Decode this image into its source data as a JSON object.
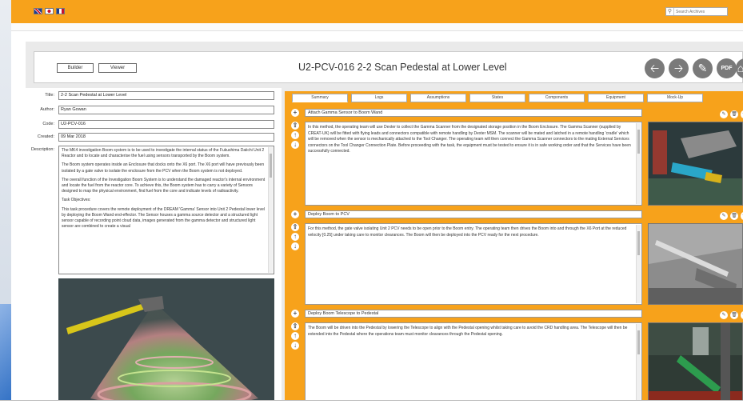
{
  "topbar": {
    "flags": [
      "flag-uk-icon",
      "flag-jp-icon",
      "flag-fr-icon"
    ],
    "search": {
      "placeholder": "Search Archives"
    }
  },
  "header": {
    "builder_label": "Builder",
    "viewer_label": "Viewer",
    "title": "U2-PCV-016 2-2 Scan Pedestal at Lower Level",
    "icons": [
      "arrow-left-icon",
      "arrow-right-icon",
      "pencil-icon",
      "pdf-icon",
      "home-icon"
    ]
  },
  "form": {
    "title_label": "Title:",
    "title_value": "2-2 Scan Pedestal at Lower Level",
    "author_label": "Author:",
    "author_value": "Ryan Gowan",
    "code_label": "Code:",
    "code_value": "U2-PCV-016",
    "created_label": "Created:",
    "created_value": "09 Mar 2018",
    "description_label": "Description:",
    "description": [
      "The MK4 investigation Boom system is to be used to investigate the internal status of the Fukushima Daiichi Unit 2 Reactor and to locate and characterise the fuel using sensors transported by the Boom system.",
      "The Boom system operates inside an Enclosure that docks onto the X6 port. The X6 port will have previously been isolated by a gate valve to isolate the enclosure from the PCV when the Boom system is not deployed.",
      "The overall function of the Investigation Boom System is to understand the damaged reactor's internal environment and locate the fuel from the reactor core. To achieve this, the Boom system has to carry a variety of Sensors designed to map the physical environment, find fuel from the core and indicate levels of radioactivity.",
      "Task Objectives:",
      "This task procedure covers the remote deployment of the DREAM 'Gamma' Sensor into Unit 2 Pedestal lower level by deploying the Boom Wand end-effector. The Sensor houses a gamma source detector and a structured light sensor capable of recording point cloud data, images generated from the gamma detector and structured light sensor are combined to create a visual"
    ]
  },
  "tabs": [
    "Summary",
    "Logs",
    "Assumptions",
    "States",
    "Components",
    "Equipment",
    "Mock-Up"
  ],
  "tasks": [
    {
      "title": "Attach Gamma Sensor to Boom Wand",
      "body": "In this method, the operating team will use Dexter to collect the Gamma Scanner from the designated storage position in the Boom Enclosure. The Gamma Scanner (supplied by CREAT-UK) will be fitted with flying leads and connectors compatible with remote handling by Dexter MSM. The scanner will be mated and latched in a remote handling 'cradle' which will be removed when the sensor is mechanically attached to the Tool Changer. The operating team will then connect the Gamma Scanner connectors to the mating External Services connectors on the Tool Changer Connection Plate. Before proceeding with the task, the equipment must be tested to ensure it is in safe working order and that the Services have been successfully connected."
    },
    {
      "title": "Deploy Boom to PCV",
      "body": "For this method, the gate valve isolating Unit 2 PCV needs to be open prior to the Boom entry. The operating team then drives the Boom into and through the X6 Port at the reduced velocity [0.25] under taking care to monitor clearances. The Boom will then be deployed into the PCV ready for the next procedure."
    },
    {
      "title": "Deploy Boom Telescope to Pedestal",
      "body": "The Boom will be driven into the Pedestal by lowering the Telescope to align with the Pedestal opening whilst taking care to avoid the CRD handling area. The Telescope will then be extended into the Pedestal where the operations team must monitor clearances through the Pedestal opening."
    }
  ],
  "colors": {
    "accent": "#f7a21b",
    "icon_gray": "#7a7a7a"
  }
}
